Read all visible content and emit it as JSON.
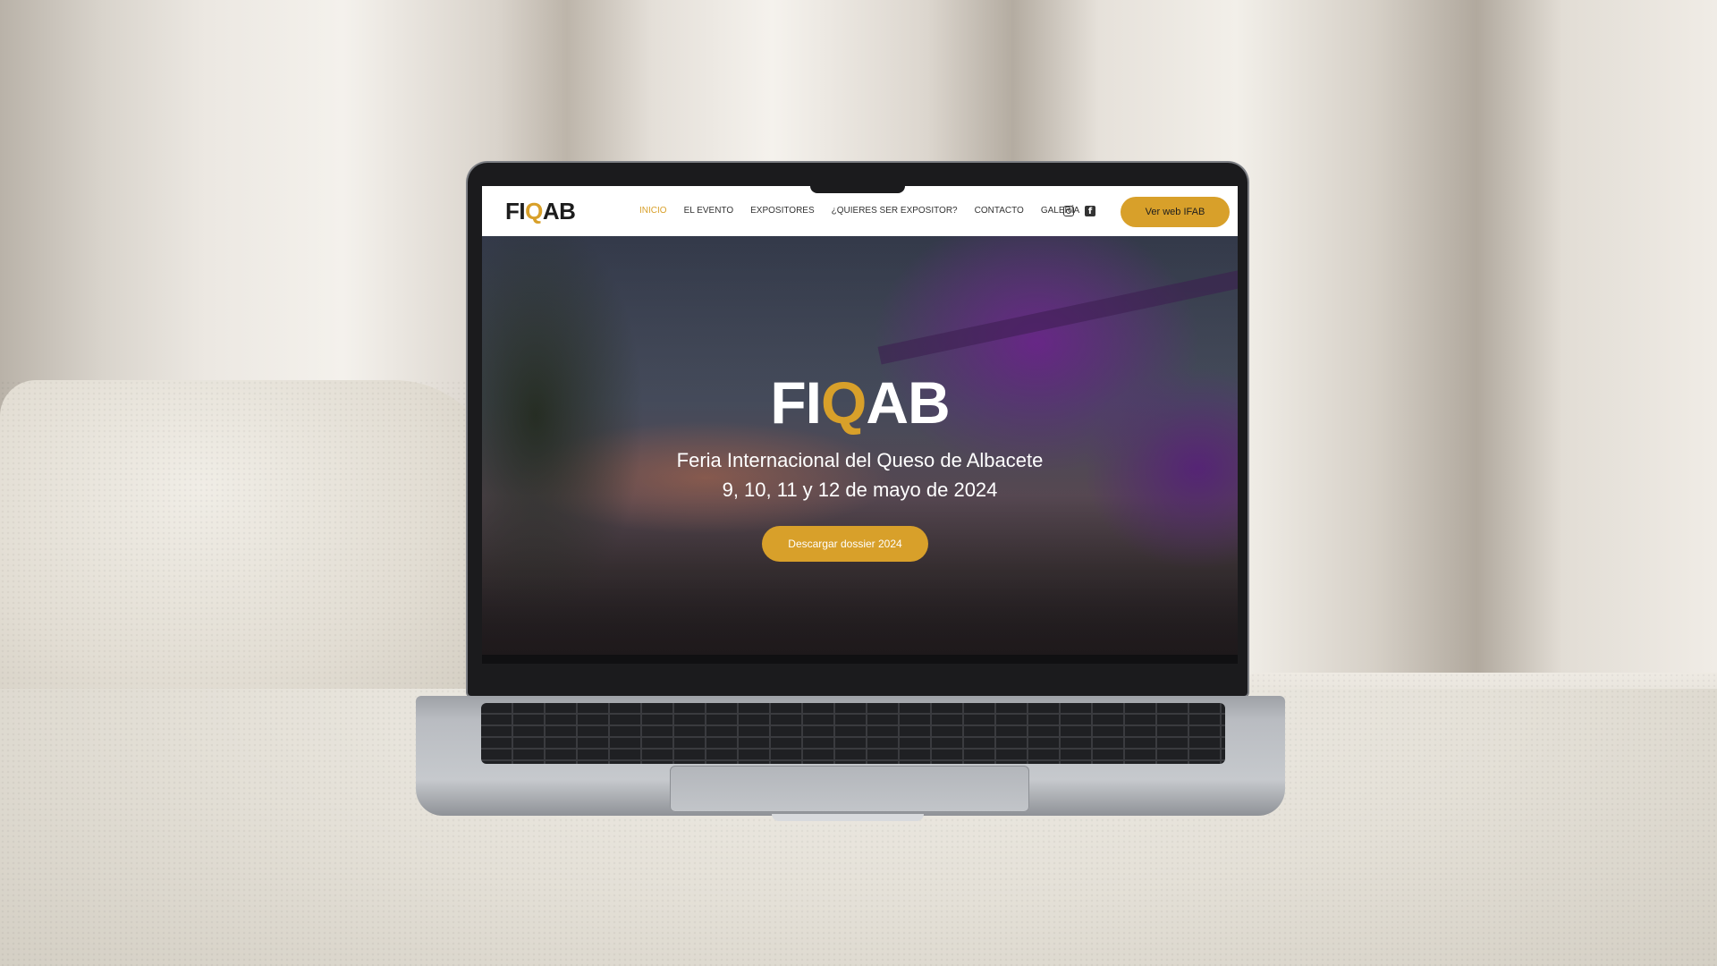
{
  "site": {
    "logo": {
      "prefix": "FI",
      "accent": "Q",
      "suffix": "AB"
    },
    "nav": {
      "items": [
        "INICIO",
        "EL EVENTO",
        "EXPOSITORES",
        "¿QUIERES SER EXPOSITOR?",
        "CONTACTO",
        "GALERÍA"
      ],
      "active": "INICIO"
    },
    "header_icons": [
      "instagram-icon",
      "facebook-icon"
    ],
    "cta_label": "Ver web IFAB",
    "hero": {
      "title": {
        "prefix": "FI",
        "accent": "Q",
        "suffix": "AB"
      },
      "subtitle": "Feria Internacional del Queso de Albacete",
      "dates": "9, 10, 11 y 12 de mayo de 2024",
      "button_label": "Descargar dossier 2024"
    }
  },
  "colors": {
    "accent": "#d8a02a",
    "header_bg": "#ffffff",
    "text_dark": "#1d1d1d",
    "hero_purple": "#8b2fb3"
  }
}
